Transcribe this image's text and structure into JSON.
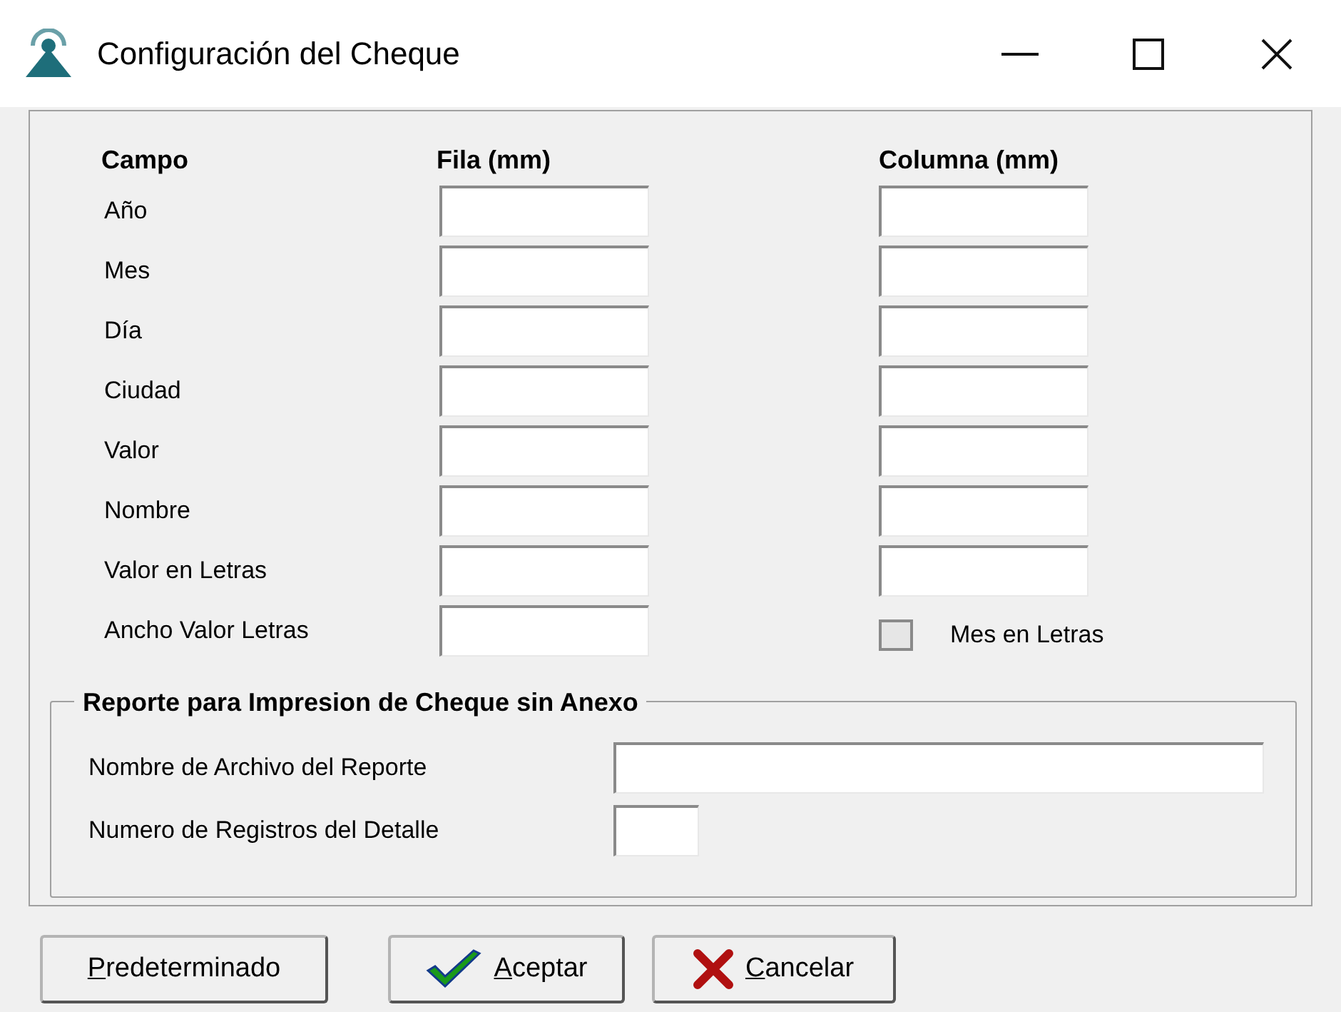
{
  "window": {
    "title": "Configuración del Cheque"
  },
  "columns": [
    "Campo",
    "Fila (mm)",
    "Columna (mm)"
  ],
  "rows": [
    {
      "label": "Año",
      "kind": "pair"
    },
    {
      "label": "Mes",
      "kind": "pair"
    },
    {
      "label": "Día",
      "kind": "pair"
    },
    {
      "label": "Ciudad",
      "kind": "pair"
    },
    {
      "label": "Valor",
      "kind": "pair"
    },
    {
      "label": "Nombre",
      "kind": "pair"
    },
    {
      "label": "Valor en Letras",
      "kind": "pair"
    },
    {
      "label": "Ancho Valor Letras",
      "kind": "single"
    }
  ],
  "mes_en_letras": {
    "label": "Mes en Letras",
    "checked": false
  },
  "report_group": {
    "title": "Reporte para Impresion de Cheque sin Anexo",
    "fields": [
      {
        "label": "Nombre de Archivo del Reporte",
        "kind": "wide"
      },
      {
        "label": "Numero de Registros del Detalle",
        "kind": "narrow"
      }
    ]
  },
  "buttons": [
    {
      "kind": "plain",
      "accel": "P",
      "label": "redeterminado"
    },
    {
      "kind": "ok",
      "accel": "A",
      "label": "ceptar"
    },
    {
      "kind": "cancel",
      "accel": "C",
      "label": "ancelar"
    }
  ]
}
